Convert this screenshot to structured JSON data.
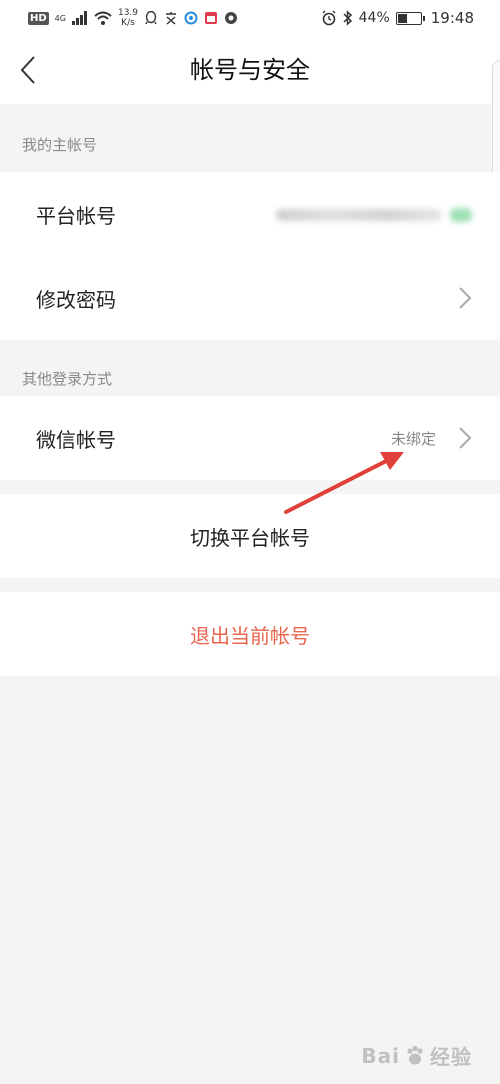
{
  "status_bar": {
    "hd": "HD",
    "network": "4G",
    "speed_value": "13.9",
    "speed_unit": "K/s",
    "battery_pct": "44%",
    "battery_level": 0.44,
    "time": "19:48",
    "icons": [
      "signal-icon",
      "wifi-icon",
      "qq-icon",
      "app-icon",
      "browser-icon",
      "calendar-icon",
      "vpn-icon",
      "alarm-icon",
      "bluetooth-icon",
      "battery-icon"
    ]
  },
  "nav": {
    "title": "帐号与安全",
    "back_icon": "back-arrow-icon"
  },
  "main_account": {
    "header": "我的主帐号",
    "rows": [
      {
        "label": "平台帐号",
        "value_blurred": true,
        "icon": "check-icon"
      },
      {
        "label": "修改密码",
        "icon": "chevron-right-icon"
      }
    ]
  },
  "other_login": {
    "header": "其他登录方式",
    "rows": [
      {
        "label": "微信帐号",
        "value": "未绑定",
        "icon": "chevron-right-icon"
      }
    ]
  },
  "actions": {
    "switch": "切换平台帐号",
    "logout": "退出当前帐号"
  },
  "colors": {
    "logout": "#e8664f",
    "annotation_arrow": "#e0403a",
    "background": "#f4f4f4"
  },
  "watermark": {
    "text": "Bai",
    "text2": "经验",
    "icon": "baidu-paw-icon"
  }
}
